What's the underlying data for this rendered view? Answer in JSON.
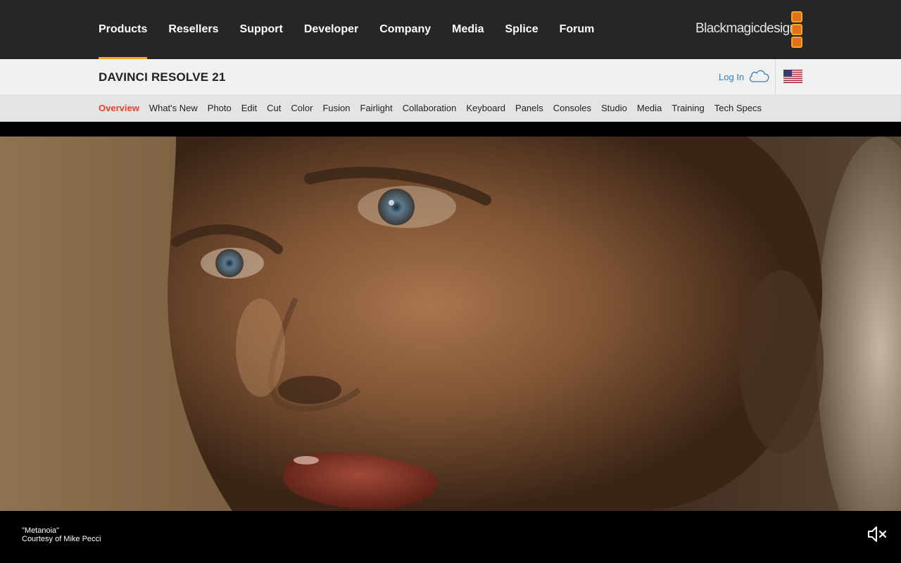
{
  "topnav": {
    "items": [
      {
        "label": "Products",
        "active": true
      },
      {
        "label": "Resellers"
      },
      {
        "label": "Support"
      },
      {
        "label": "Developer"
      },
      {
        "label": "Company"
      },
      {
        "label": "Media"
      },
      {
        "label": "Splice"
      },
      {
        "label": "Forum"
      }
    ],
    "logo_text": "Blackmagicdesign",
    "accent": "#f5a623"
  },
  "product_bar": {
    "title": "DAVINCI RESOLVE 21",
    "login_label": "Log In",
    "login_icon": "cloud-icon",
    "region_icon": "us-flag-icon"
  },
  "subnav": {
    "links": [
      {
        "label": "Overview",
        "active": true
      },
      {
        "label": "What's New"
      },
      {
        "label": "Photo"
      },
      {
        "label": "Edit"
      },
      {
        "label": "Cut"
      },
      {
        "label": "Color"
      },
      {
        "label": "Fusion"
      },
      {
        "label": "Fairlight"
      },
      {
        "label": "Collaboration"
      },
      {
        "label": "Keyboard"
      },
      {
        "label": "Panels"
      },
      {
        "label": "Consoles"
      },
      {
        "label": "Studio"
      },
      {
        "label": "Media"
      },
      {
        "label": "Training"
      },
      {
        "label": "Tech Specs"
      }
    ],
    "active_color": "#e8412c"
  },
  "hero": {
    "credit_title": "\"Metanoia\"",
    "credit_line": "Courtesy of Mike Pecci",
    "mute_icon": "speaker-muted-icon"
  }
}
